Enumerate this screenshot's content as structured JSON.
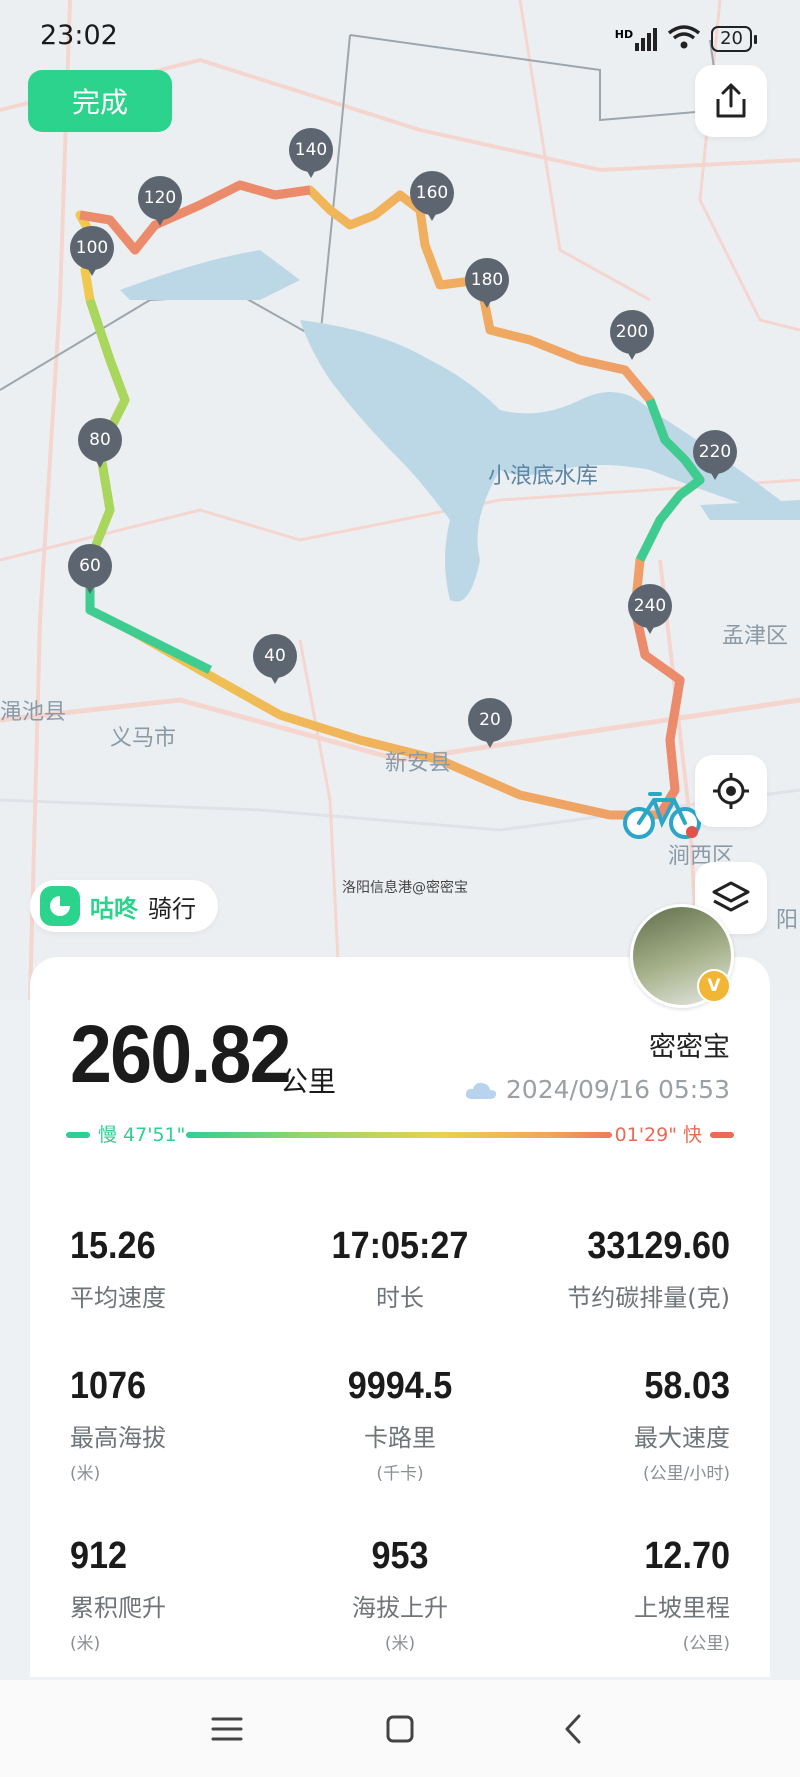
{
  "status_bar": {
    "time": "23:02",
    "battery": "20",
    "network": "HD"
  },
  "header": {
    "done_label": "完成"
  },
  "map": {
    "labels": {
      "lake": "小浪底水库",
      "mengjin": "孟津区",
      "mianchi": "渑池县",
      "yima": "义马市",
      "xinan": "新安县",
      "jianxi": "涧西区",
      "luoyang": "阳"
    },
    "km_markers": [
      "20",
      "40",
      "60",
      "80",
      "100",
      "120",
      "140",
      "160",
      "180",
      "200",
      "220",
      "240"
    ],
    "watermark": "洛阳信息港@密密宝"
  },
  "brand": {
    "name": "咕咚",
    "activity": "骑行"
  },
  "summary": {
    "distance": "260.82",
    "distance_unit": "公里",
    "username": "密密宝",
    "datetime": "2024/09/16 05:53",
    "slow_label": "慢 47'51\"",
    "fast_label": "01'29\" 快",
    "verified_badge": "V"
  },
  "stats": [
    {
      "value": "15.26",
      "label": "平均速度",
      "sub": ""
    },
    {
      "value": "17:05:27",
      "label": "时长",
      "sub": ""
    },
    {
      "value": "33129.60",
      "label": "节约碳排量(克)",
      "sub": ""
    },
    {
      "value": "1076",
      "label": "最高海拔",
      "sub": "(米)"
    },
    {
      "value": "9994.5",
      "label": "卡路里",
      "sub": "(千卡)"
    },
    {
      "value": "58.03",
      "label": "最大速度",
      "sub": "(公里/小时)"
    },
    {
      "value": "912",
      "label": "累积爬升",
      "sub": "(米)"
    },
    {
      "value": "953",
      "label": "海拔上升",
      "sub": "(米)"
    },
    {
      "value": "12.70",
      "label": "上坡里程",
      "sub": "(公里)"
    }
  ],
  "colors": {
    "accent": "#2bd38d",
    "slow": "#2fcf93",
    "fast": "#ec6a55",
    "marker": "#5d6670"
  },
  "icons": [
    "share-icon",
    "locate-icon",
    "layers-icon",
    "bicycle-icon",
    "weather-cloud-icon",
    "menu-icon",
    "home-icon",
    "back-icon"
  ]
}
